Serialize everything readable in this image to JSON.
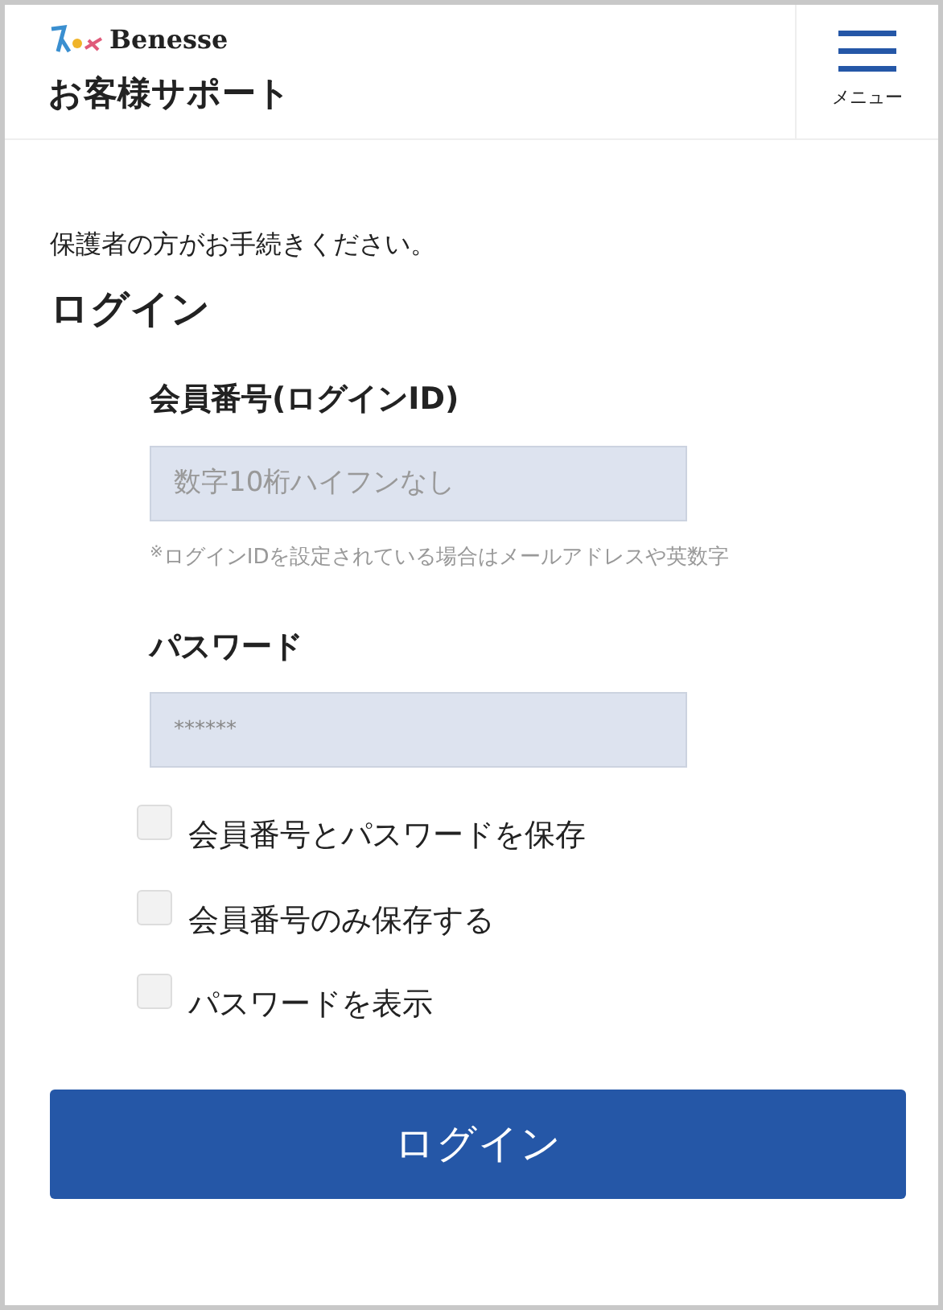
{
  "header": {
    "logo_text": "Benesse",
    "title": "お客様サポート",
    "menu_label": "メニュー"
  },
  "intro": "保護者の方がお手続きください。",
  "heading": "ログイン",
  "member_id": {
    "label": "会員番号(ログインID)",
    "placeholder": "数字10桁ハイフンなし",
    "note_mark": "※",
    "note": "ログインIDを設定されている場合はメールアドレスや英数字"
  },
  "password": {
    "label": "パスワード",
    "placeholder": "******"
  },
  "options": [
    {
      "label": "会員番号とパスワードを保存",
      "checked": false
    },
    {
      "label": "会員番号のみ保存する",
      "checked": false
    },
    {
      "label": "パスワードを表示",
      "checked": false
    }
  ],
  "login_button": "ログイン"
}
